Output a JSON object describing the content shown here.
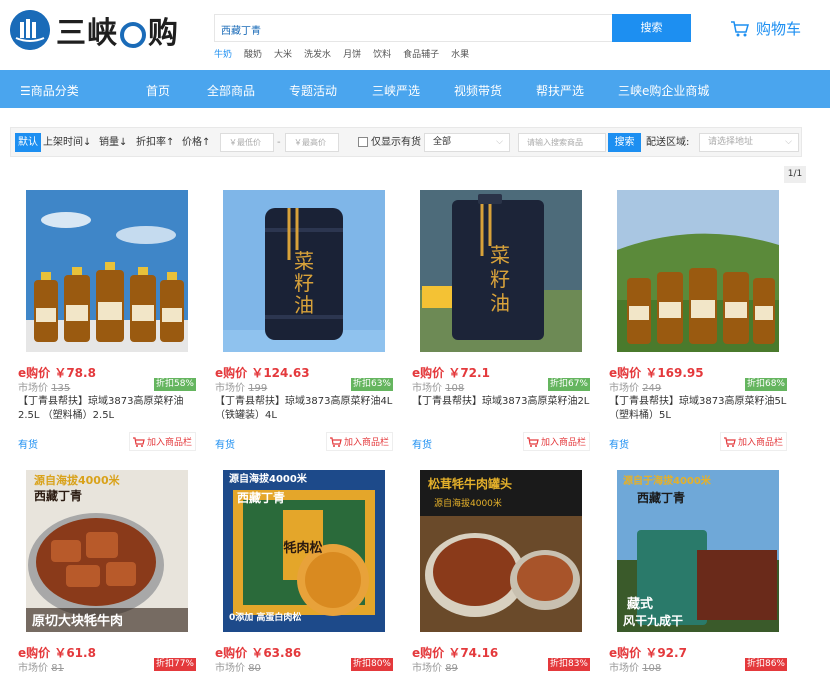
{
  "header": {
    "logo_text": "三峡",
    "logo_text2": "购",
    "search_value": "西藏丁青",
    "search_button": "搜索",
    "hotwords": [
      "牛奶",
      "酸奶",
      "大米",
      "洗发水",
      "月饼",
      "饮料",
      "食品辅子",
      "水果"
    ],
    "cart_label": "购物车"
  },
  "nav": {
    "category": "☰商品分类",
    "items": [
      "首页",
      "全部商品",
      "专题活动",
      "三峡严选",
      "视频带货",
      "帮扶严选",
      "三峡e购企业商城"
    ]
  },
  "filters": {
    "default": "默认",
    "sort_time": "上架时间↓",
    "sort_sales": "销量↓",
    "sort_discount": "折扣率↑",
    "sort_price": "价格↑",
    "min_price": "￥最低价",
    "dash": "-",
    "max_price": "￥最高价",
    "in_stock": "仅显示有货",
    "select_all": "全部",
    "search_placeholder": "请输入搜索商品",
    "search_button": "搜索",
    "delivery_label": "配送区域:",
    "address_placeholder": "请选择地址"
  },
  "pager": "1/1",
  "products": [
    {
      "price": "e购价 ￥78.8",
      "market_label": "市场价",
      "market": "135",
      "discount": "折扣58%",
      "title": "【丁青县帮扶】琼域3873高原菜籽油2.5L （塑料桶）2.5L",
      "stock": "有货",
      "add": "加入商品栏"
    },
    {
      "price": "e购价 ￥124.63",
      "market_label": "市场价",
      "market": "199",
      "discount": "折扣63%",
      "title": "【丁青县帮扶】琼域3873高原菜籽油4L（铁罐装）4L",
      "stock": "有货",
      "add": "加入商品栏"
    },
    {
      "price": "e购价 ￥72.1",
      "market_label": "市场价",
      "market": "108",
      "discount": "折扣67%",
      "title": "【丁青县帮扶】琼域3873高原菜籽油2L",
      "stock": "有货",
      "add": "加入商品栏"
    },
    {
      "price": "e购价 ￥169.95",
      "market_label": "市场价",
      "market": "249",
      "discount": "折扣68%",
      "title": "【丁青县帮扶】琼域3873高原菜籽油5L（塑料桶）5L",
      "stock": "有货",
      "add": "加入商品栏"
    },
    {
      "price": "e购价 ￥61.8",
      "market_label": "市场价",
      "market": "81",
      "discount": "折扣77%"
    },
    {
      "price": "e购价 ￥63.86",
      "market_label": "市场价",
      "market": "80",
      "discount": "折扣80%"
    },
    {
      "price": "e购价 ￥74.16",
      "market_label": "市场价",
      "market": "89",
      "discount": "折扣83%"
    },
    {
      "price": "e购价 ￥92.7",
      "market_label": "市场价",
      "market": "108",
      "discount": "折扣86%"
    }
  ],
  "image_texts": {
    "p5_top": "源自海拔4000米",
    "p5_mid": "西藏丁青",
    "p5_bottom": "原切大块牦牛肉",
    "p6_top": "源自海拔4000米",
    "p6_mid": "西藏丁青",
    "p6_center": "牦肉松",
    "p6_bottom": "0添加 高蛋白肉松",
    "p7_top": "松茸牦牛肉罐头",
    "p7_mid": "源自海拔4000米",
    "p8_top": "源自于海拔4000米",
    "p8_mid": "西藏丁青",
    "p8_bottom1": "藏式",
    "p8_bottom2": "风干九成干"
  }
}
